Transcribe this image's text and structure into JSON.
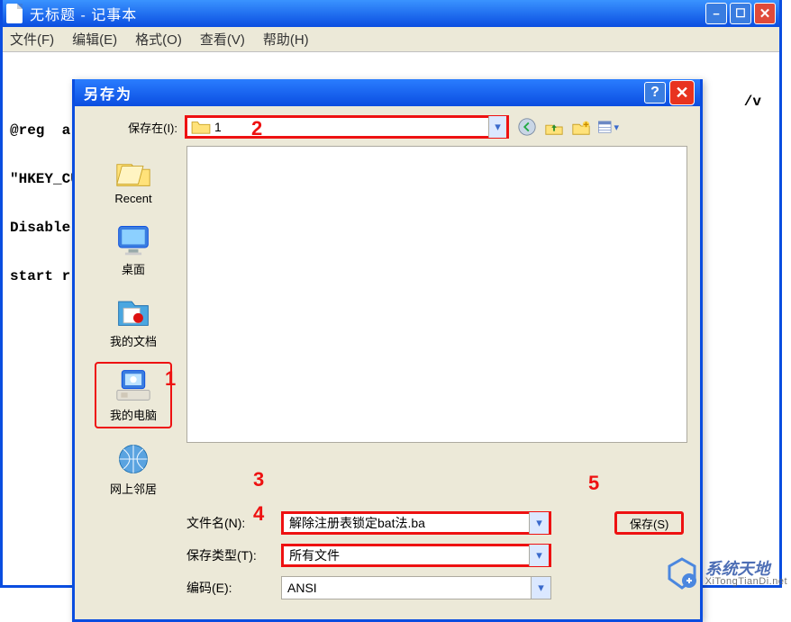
{
  "main_window": {
    "title": "无标题 - 记事本",
    "menu": {
      "file": "文件(F)",
      "edit": "编辑(E)",
      "format": "格式(O)",
      "view": "查看(V)",
      "help": "帮助(H)"
    },
    "editor_lines": [
      "@reg  a",
      "\"HKEY_CU",
      "Disable",
      "start r"
    ],
    "editor_tail": "/v"
  },
  "dialog": {
    "title": "另存为",
    "save_in_label": "保存在(I):",
    "location_name": "1",
    "places": [
      {
        "key": "recent",
        "label": "Recent"
      },
      {
        "key": "desktop",
        "label": "桌面"
      },
      {
        "key": "mydocs",
        "label": "我的文档"
      },
      {
        "key": "mycomputer",
        "label": "我的电脑"
      },
      {
        "key": "network",
        "label": "网上邻居"
      }
    ],
    "filename_label": "文件名(N):",
    "filename_value": "解除注册表锁定bat法.ba",
    "filetype_label": "保存类型(T):",
    "filetype_value": "所有文件",
    "encoding_label": "编码(E):",
    "encoding_value": "ANSI",
    "save_button": "保存(S)"
  },
  "annotations": {
    "a1": "1",
    "a2": "2",
    "a3": "3",
    "a4": "4",
    "a5": "5"
  },
  "watermark": {
    "line1": "系统天地",
    "line2": "XiTongTianDi.net"
  }
}
